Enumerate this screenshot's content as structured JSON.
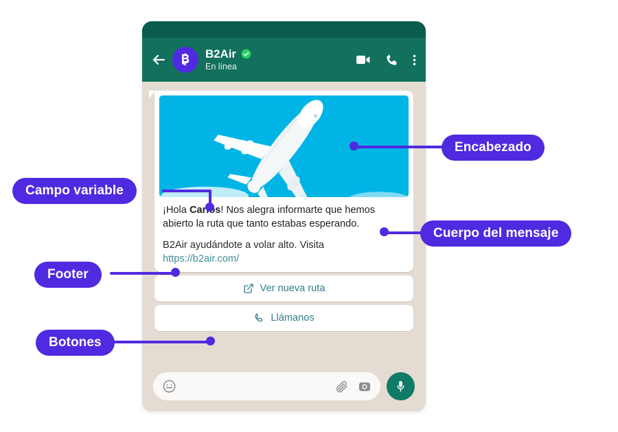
{
  "phone": {
    "header": {
      "back_icon": "back-arrow-icon",
      "avatar_letter": "B",
      "contact_name": "B2Air",
      "verified_icon": "verified-badge-icon",
      "status": "En línea",
      "video_icon": "video-call-icon",
      "call_icon": "voice-call-icon",
      "menu_icon": "overflow-menu-icon"
    },
    "message": {
      "media_icon": "airplane-image",
      "body_greeting": "¡Hola ",
      "body_variable": "Carlos",
      "body_rest": "! Nos alegra informarte que hemos abierto la ruta que tanto estabas esperando.",
      "footer_text": "B2Air ayudándote a volar alto. Visita",
      "footer_link": "https://b2air.com/",
      "buttons": [
        {
          "label": "Ver nueva ruta",
          "icon": "external-link-icon"
        },
        {
          "label": "Llámanos",
          "icon": "phone-icon"
        }
      ]
    },
    "composer": {
      "placeholder": "",
      "value": "",
      "emoji_icon": "emoji-icon",
      "attach_icon": "paperclip-icon",
      "camera_icon": "camera-icon",
      "mic_icon": "microphone-icon"
    }
  },
  "annotations": {
    "header_label": "Encabezado",
    "variable_label": "Campo variable",
    "body_label": "Cuerpo del mensaje",
    "footer_label": "Footer",
    "buttons_label": "Botones"
  },
  "colors": {
    "accent_purple": "#4f2ae0",
    "whatsapp_header": "#12705c",
    "status_bar": "#0a5c4d",
    "chat_bg": "#e4dcd3",
    "media_blue": "#00b4e6",
    "link_teal": "#3e8e9b",
    "cta_teal": "#347d8c",
    "verified_green": "#25d366",
    "mic_green": "#0f7a65"
  }
}
